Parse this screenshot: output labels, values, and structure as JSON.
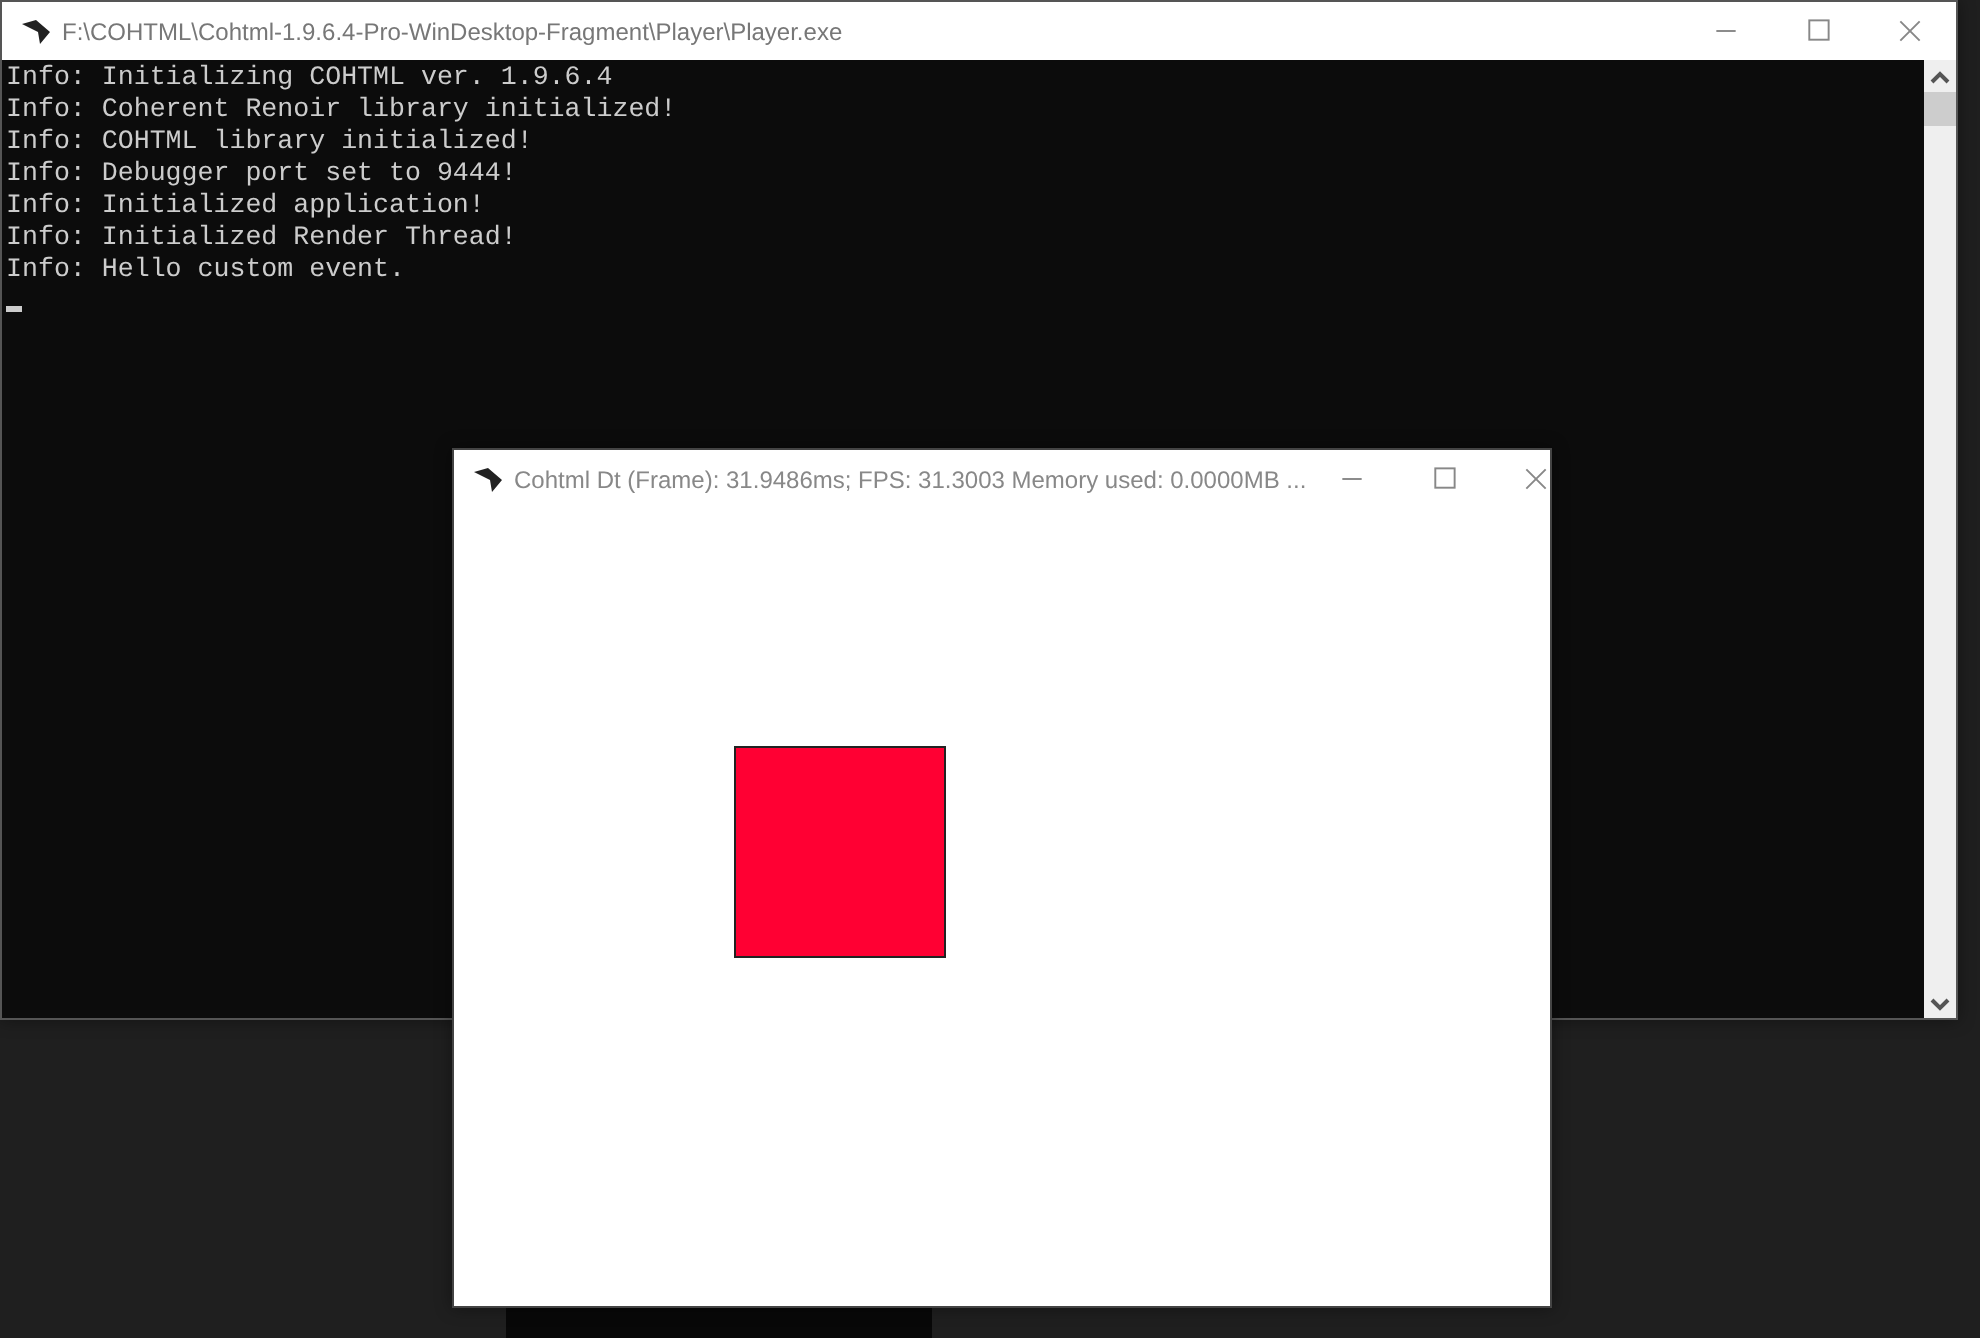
{
  "console_window": {
    "title": "F:\\COHTML\\Cohtml-1.9.6.4-Pro-WinDesktop-Fragment\\Player\\Player.exe",
    "lines": [
      "Info: Initializing COHTML ver. 1.9.6.4",
      "Info: Coherent Renoir library initialized!",
      "Info: COHTML library initialized!",
      "Info: Debugger port set to 9444!",
      "Info: Initialized application!",
      "Info: Initialized Render Thread!",
      "Info: Hello custom event."
    ]
  },
  "view_window": {
    "title": "Cohtml Dt (Frame): 31.9486ms; FPS: 31.3003 Memory used: 0.0000MB ...",
    "shape": {
      "color": "#ff0033"
    }
  }
}
